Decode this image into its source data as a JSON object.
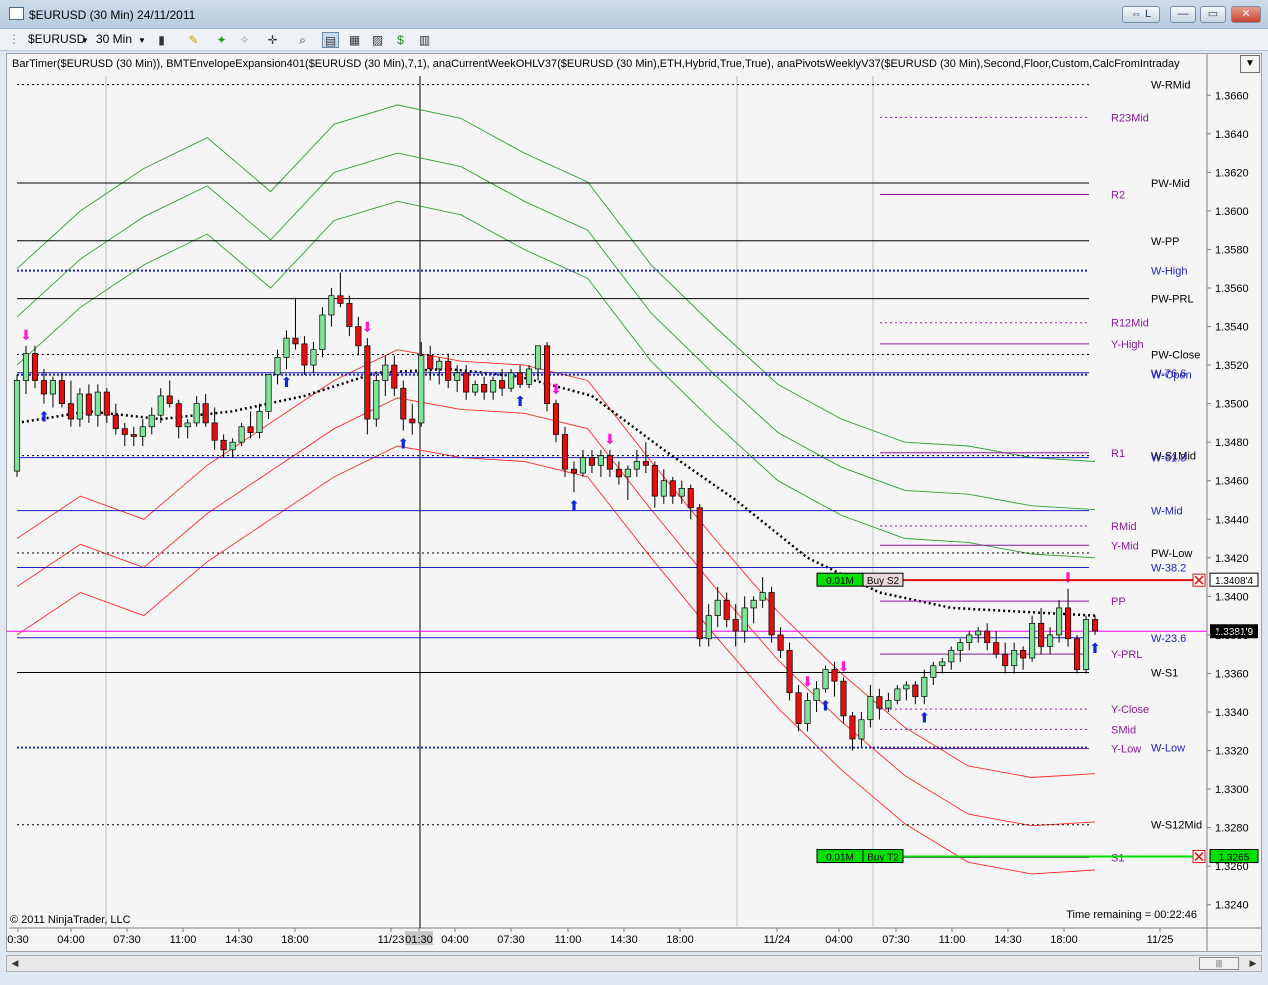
{
  "window": {
    "title": "$EURUSD (30 Min)  24/11/2011",
    "buttons": [
      "⇔ L",
      "—",
      "▭",
      "✕"
    ]
  },
  "toolbar": {
    "instrument": "$EURUSD",
    "interval": "30 Min"
  },
  "indicator_label": "BarTimer($EURUSD (30 Min)), BMTEnvelopeExpansion401($EURUSD (30 Min),7,1), anaCurrentWeekOHLV37($EURUSD (30 Min),ETH,Hybrid,True,True), anaPivotsWeeklyV37($EURUSD (30 Min),Second,Floor,Custom,CalcFromIntraday",
  "copyright": "© 2011 NinjaTrader, LLC",
  "time_remaining": "Time remaining = 00:22:46",
  "colors": {
    "up": "#7fe39a",
    "down": "#e01010",
    "green_env": "#2ea02e",
    "red_env": "#ff2a2a",
    "pivot": "#8b1a9e",
    "weekly_blue": "#1f1fbf",
    "dotted_black": "#000000",
    "crosshair": "#ff00ff"
  },
  "chart_data": {
    "type": "candlestick",
    "instrument": "$EURUSD",
    "timeframe": "30 Min",
    "y_range": [
      1.323,
      1.367
    ],
    "y_ticks": [
      "1.3660",
      "1.3640",
      "1.3620",
      "1.3600",
      "1.3580",
      "1.3560",
      "1.3540",
      "1.3520",
      "1.3500",
      "1.3480",
      "1.3460",
      "1.3440",
      "1.3420",
      "1.3400",
      "1.3380",
      "1.3360",
      "1.3340",
      "1.3320",
      "1.3300",
      "1.3280",
      "1.3260",
      "1.3240"
    ],
    "x_ticks": [
      "0:30",
      "04:00",
      "07:30",
      "11:00",
      "14:30",
      "18:00",
      "11/23",
      "01:30",
      "04:00",
      "07:30",
      "11:00",
      "14:30",
      "18:00",
      "11/24",
      "04:00",
      "07:30",
      "11:00",
      "14:30",
      "18:00",
      "11/25"
    ],
    "candles": [
      [
        1.3465,
        1.3515,
        1.3462,
        1.3512
      ],
      [
        1.3512,
        1.353,
        1.3505,
        1.3526
      ],
      [
        1.3526,
        1.353,
        1.3508,
        1.3512
      ],
      [
        1.3512,
        1.3518,
        1.35,
        1.3505
      ],
      [
        1.3505,
        1.3514,
        1.3498,
        1.3512
      ],
      [
        1.3512,
        1.3516,
        1.3498,
        1.35
      ],
      [
        1.35,
        1.3512,
        1.3488,
        1.3492
      ],
      [
        1.3492,
        1.3508,
        1.3488,
        1.3505
      ],
      [
        1.3505,
        1.351,
        1.349,
        1.3494
      ],
      [
        1.3494,
        1.351,
        1.3488,
        1.3506
      ],
      [
        1.3506,
        1.3508,
        1.349,
        1.3494
      ],
      [
        1.3494,
        1.35,
        1.3484,
        1.3487
      ],
      [
        1.3487,
        1.349,
        1.3478,
        1.3484
      ],
      [
        1.3484,
        1.3488,
        1.3478,
        1.3483
      ],
      [
        1.3483,
        1.3492,
        1.3478,
        1.3488
      ],
      [
        1.3488,
        1.3498,
        1.3484,
        1.3494
      ],
      [
        1.3494,
        1.3508,
        1.349,
        1.3504
      ],
      [
        1.3504,
        1.3512,
        1.3498,
        1.35
      ],
      [
        1.35,
        1.3502,
        1.3482,
        1.3488
      ],
      [
        1.3488,
        1.3492,
        1.3482,
        1.349
      ],
      [
        1.349,
        1.3504,
        1.3488,
        1.35
      ],
      [
        1.35,
        1.3505,
        1.3488,
        1.349
      ],
      [
        1.349,
        1.3498,
        1.3476,
        1.3481
      ],
      [
        1.3481,
        1.3484,
        1.3472,
        1.3476
      ],
      [
        1.3476,
        1.3482,
        1.3472,
        1.348
      ],
      [
        1.348,
        1.349,
        1.3478,
        1.3488
      ],
      [
        1.3488,
        1.3496,
        1.3482,
        1.3485
      ],
      [
        1.3485,
        1.35,
        1.3482,
        1.3496
      ],
      [
        1.3496,
        1.3515,
        1.3492,
        1.3515
      ],
      [
        1.3515,
        1.3528,
        1.351,
        1.3524
      ],
      [
        1.3524,
        1.3538,
        1.3518,
        1.3534
      ],
      [
        1.3534,
        1.3555,
        1.3528,
        1.3531
      ],
      [
        1.3531,
        1.3535,
        1.3515,
        1.352
      ],
      [
        1.352,
        1.3532,
        1.3516,
        1.3528
      ],
      [
        1.3528,
        1.355,
        1.3524,
        1.3546
      ],
      [
        1.3546,
        1.356,
        1.354,
        1.3556
      ],
      [
        1.3556,
        1.3568,
        1.355,
        1.3552
      ],
      [
        1.3552,
        1.3556,
        1.3535,
        1.354
      ],
      [
        1.354,
        1.3545,
        1.3525,
        1.353
      ],
      [
        1.353,
        1.3534,
        1.3484,
        1.3492
      ],
      [
        1.3492,
        1.3515,
        1.3488,
        1.3512
      ],
      [
        1.3512,
        1.3525,
        1.3504,
        1.352
      ],
      [
        1.352,
        1.3525,
        1.3504,
        1.3508
      ],
      [
        1.3508,
        1.3512,
        1.3486,
        1.3492
      ],
      [
        1.3492,
        1.35,
        1.3484,
        1.349
      ],
      [
        1.349,
        1.3532,
        1.3488,
        1.3525
      ],
      [
        1.3525,
        1.353,
        1.3512,
        1.3518
      ],
      [
        1.3518,
        1.3524,
        1.351,
        1.3522
      ],
      [
        1.3522,
        1.3526,
        1.3508,
        1.3512
      ],
      [
        1.3512,
        1.352,
        1.3506,
        1.3516
      ],
      [
        1.3516,
        1.352,
        1.3502,
        1.3506
      ],
      [
        1.3506,
        1.3512,
        1.3504,
        1.351
      ],
      [
        1.351,
        1.3514,
        1.3502,
        1.3506
      ],
      [
        1.3506,
        1.3514,
        1.3502,
        1.3512
      ],
      [
        1.3512,
        1.3518,
        1.3504,
        1.3508
      ],
      [
        1.3508,
        1.3518,
        1.3506,
        1.3516
      ],
      [
        1.3516,
        1.352,
        1.3508,
        1.351
      ],
      [
        1.351,
        1.352,
        1.3508,
        1.3518
      ],
      [
        1.3518,
        1.353,
        1.3512,
        1.353
      ],
      [
        1.353,
        1.3532,
        1.3496,
        1.35
      ],
      [
        1.35,
        1.3502,
        1.348,
        1.3484
      ],
      [
        1.3484,
        1.3488,
        1.3462,
        1.3466
      ],
      [
        1.3466,
        1.347,
        1.3454,
        1.3464
      ],
      [
        1.3464,
        1.3476,
        1.3462,
        1.3472
      ],
      [
        1.3472,
        1.3476,
        1.3464,
        1.3468
      ],
      [
        1.3468,
        1.3476,
        1.3462,
        1.3473
      ],
      [
        1.3473,
        1.3476,
        1.3462,
        1.3466
      ],
      [
        1.3466,
        1.347,
        1.3458,
        1.3462
      ],
      [
        1.3462,
        1.3468,
        1.345,
        1.3466
      ],
      [
        1.3466,
        1.3476,
        1.3462,
        1.347
      ],
      [
        1.347,
        1.348,
        1.3464,
        1.3468
      ],
      [
        1.3468,
        1.347,
        1.3446,
        1.3452
      ],
      [
        1.3452,
        1.3466,
        1.3448,
        1.346
      ],
      [
        1.346,
        1.3462,
        1.3448,
        1.3452
      ],
      [
        1.3452,
        1.346,
        1.3448,
        1.3456
      ],
      [
        1.3456,
        1.3458,
        1.344,
        1.3446
      ],
      [
        1.3446,
        1.3448,
        1.3374,
        1.3378
      ],
      [
        1.3378,
        1.3396,
        1.3374,
        1.339
      ],
      [
        1.339,
        1.3405,
        1.3384,
        1.3398
      ],
      [
        1.3398,
        1.3402,
        1.3384,
        1.3388
      ],
      [
        1.3388,
        1.3396,
        1.3374,
        1.3382
      ],
      [
        1.3382,
        1.34,
        1.3376,
        1.3394
      ],
      [
        1.3394,
        1.34,
        1.3386,
        1.3398
      ],
      [
        1.3398,
        1.341,
        1.3394,
        1.3402
      ],
      [
        1.3402,
        1.3405,
        1.3376,
        1.338
      ],
      [
        1.338,
        1.3384,
        1.3368,
        1.3372
      ],
      [
        1.3372,
        1.3376,
        1.3346,
        1.335
      ],
      [
        1.335,
        1.3354,
        1.333,
        1.3334
      ],
      [
        1.3334,
        1.335,
        1.333,
        1.3346
      ],
      [
        1.3346,
        1.3356,
        1.334,
        1.3352
      ],
      [
        1.3352,
        1.3364,
        1.335,
        1.3362
      ],
      [
        1.3362,
        1.3366,
        1.3348,
        1.3356
      ],
      [
        1.3356,
        1.3358,
        1.3334,
        1.3338
      ],
      [
        1.3338,
        1.334,
        1.332,
        1.3326
      ],
      [
        1.3326,
        1.334,
        1.3322,
        1.3336
      ],
      [
        1.3336,
        1.3354,
        1.3332,
        1.3348
      ],
      [
        1.3348,
        1.3352,
        1.3336,
        1.3342
      ],
      [
        1.3342,
        1.335,
        1.334,
        1.3346
      ],
      [
        1.3346,
        1.3354,
        1.3344,
        1.3352
      ],
      [
        1.3352,
        1.3356,
        1.3346,
        1.3354
      ],
      [
        1.3354,
        1.3356,
        1.3344,
        1.3348
      ],
      [
        1.3348,
        1.3362,
        1.3344,
        1.3358
      ],
      [
        1.3358,
        1.3366,
        1.3354,
        1.3364
      ],
      [
        1.3364,
        1.3368,
        1.336,
        1.3366
      ],
      [
        1.3366,
        1.3374,
        1.3362,
        1.3372
      ],
      [
        1.3372,
        1.3378,
        1.3366,
        1.3376
      ],
      [
        1.3376,
        1.3382,
        1.3372,
        1.338
      ],
      [
        1.338,
        1.3384,
        1.3376,
        1.3382
      ],
      [
        1.3382,
        1.3386,
        1.3372,
        1.3376
      ],
      [
        1.3376,
        1.3382,
        1.3368,
        1.337
      ],
      [
        1.337,
        1.3376,
        1.336,
        1.3364
      ],
      [
        1.3364,
        1.3376,
        1.336,
        1.3372
      ],
      [
        1.3372,
        1.3374,
        1.3362,
        1.3368
      ],
      [
        1.3368,
        1.339,
        1.3366,
        1.3386
      ],
      [
        1.3386,
        1.3394,
        1.337,
        1.3374
      ],
      [
        1.3374,
        1.3384,
        1.337,
        1.338
      ],
      [
        1.338,
        1.3398,
        1.3376,
        1.3394
      ],
      [
        1.3394,
        1.3404,
        1.3374,
        1.3378
      ],
      [
        1.3378,
        1.338,
        1.336,
        1.3362
      ],
      [
        1.3362,
        1.339,
        1.336,
        1.3388
      ],
      [
        1.3388,
        1.339,
        1.338,
        1.3382
      ]
    ],
    "envelope_green": [
      1.357,
      1.36,
      1.3622,
      1.3638,
      1.361,
      1.3645,
      1.3655,
      1.3648,
      1.363,
      1.3615,
      1.3572,
      1.354,
      1.351,
      1.3492,
      1.348,
      1.3478,
      1.3472,
      1.347
    ],
    "envelope_red": [
      1.338,
      1.3402,
      1.339,
      1.3418,
      1.344,
      1.3462,
      1.3478,
      1.3472,
      1.347,
      1.3462,
      1.342,
      1.338,
      1.3342,
      1.331,
      1.3282,
      1.3262,
      1.3256,
      1.3258
    ],
    "dotted_ma": [
      1.349,
      1.3496,
      1.3492,
      1.3496,
      1.3504,
      1.3516,
      1.3518,
      1.3514,
      1.3504,
      1.3476,
      1.345,
      1.342,
      1.3402,
      1.3394,
      1.3392,
      1.339
    ],
    "levels": [
      {
        "price": 1.36655,
        "label": "W-RMid",
        "color": "#000000",
        "style": "dotted",
        "from": "left"
      },
      {
        "price": 1.36485,
        "label": "R23Mid",
        "color": "#8b1a9e",
        "style": "dotted",
        "from": "right"
      },
      {
        "price": 1.36145,
        "label": "PW-Mid",
        "color": "#000000",
        "style": "solid",
        "from": "left"
      },
      {
        "price": 1.36085,
        "label": "R2",
        "color": "#8b1a9e",
        "style": "solid",
        "from": "right"
      },
      {
        "price": 1.35845,
        "label": "W-PP",
        "color": "#000000",
        "style": "solid",
        "from": "left"
      },
      {
        "price": 1.3569,
        "label": "W-High",
        "color": "#1f1fbf",
        "style": "dotted",
        "from": "left"
      },
      {
        "price": 1.35545,
        "label": "PW-PRL",
        "color": "#000000",
        "style": "solid",
        "from": "left"
      },
      {
        "price": 1.3542,
        "label": "R12Mid",
        "color": "#8b1a9e",
        "style": "dotted",
        "from": "right"
      },
      {
        "price": 1.3531,
        "label": "Y-High",
        "color": "#8b1a9e",
        "style": "solid",
        "from": "right"
      },
      {
        "price": 1.35255,
        "label": "PW-Close",
        "color": "#000000",
        "style": "dotted",
        "from": "left"
      },
      {
        "price": 1.3515,
        "label": "W-Open",
        "color": "#1f1fbf",
        "style": "dotted",
        "from": "left"
      },
      {
        "price": 1.3516,
        "label": "W-76.6",
        "color": "#1f1fbf",
        "style": "solid",
        "from": "left"
      },
      {
        "price": 1.34745,
        "label": "R1",
        "color": "#8b1a9e",
        "style": "solid",
        "from": "right"
      },
      {
        "price": 1.3473,
        "label": "W-S1Mid",
        "color": "#000000",
        "style": "dotted",
        "from": "left"
      },
      {
        "price": 1.3472,
        "label": "W-61.8",
        "color": "#1f1fbf",
        "style": "solid",
        "from": "left"
      },
      {
        "price": 1.34445,
        "label": "W-Mid",
        "color": "#1f1fbf",
        "style": "solid",
        "from": "left"
      },
      {
        "price": 1.34365,
        "label": "RMid",
        "color": "#8b1a9e",
        "style": "dotted",
        "from": "right"
      },
      {
        "price": 1.34265,
        "label": "Y-Mid",
        "color": "#8b1a9e",
        "style": "solid",
        "from": "right"
      },
      {
        "price": 1.34225,
        "label": "PW-Low",
        "color": "#000000",
        "style": "dotted",
        "from": "left"
      },
      {
        "price": 1.3415,
        "label": "W-38.2",
        "color": "#1f1fbf",
        "style": "solid",
        "from": "left"
      },
      {
        "price": 1.33975,
        "label": "PP",
        "color": "#8b1a9e",
        "style": "solid",
        "from": "right"
      },
      {
        "price": 1.33785,
        "label": "W-23.6",
        "color": "#1f1fbf",
        "style": "solid",
        "from": "left"
      },
      {
        "price": 1.337,
        "label": "Y-PRL",
        "color": "#8b1a9e",
        "style": "solid",
        "from": "right"
      },
      {
        "price": 1.33605,
        "label": "W-S1",
        "color": "#000000",
        "style": "solid",
        "from": "left"
      },
      {
        "price": 1.33415,
        "label": "Y-Close",
        "color": "#8b1a9e",
        "style": "dotted",
        "from": "right"
      },
      {
        "price": 1.3331,
        "label": "SMid",
        "color": "#8b1a9e",
        "style": "dotted",
        "from": "right"
      },
      {
        "price": 1.3321,
        "label": "Y-Low",
        "color": "#8b1a9e",
        "style": "solid",
        "from": "right"
      },
      {
        "price": 1.33215,
        "label": "W-Low",
        "color": "#1f1fbf",
        "style": "dotted",
        "from": "left"
      },
      {
        "price": 1.32815,
        "label": "W-S12Mid",
        "color": "#000000",
        "style": "dotted",
        "from": "left"
      },
      {
        "price": 1.32645,
        "label": "S1",
        "color": "#8b1a9e",
        "style": "solid",
        "from": "right"
      }
    ],
    "orders": [
      {
        "price": 1.34084,
        "qty": "0.01M",
        "label": "Buy S2",
        "tag": "1.3408'4",
        "color": "#e8d8d8"
      },
      {
        "price": 1.3265,
        "qty": "0.01M",
        "label": "Buy T2",
        "tag": "1.3265",
        "color": "#00e000"
      }
    ],
    "last_price_tag": "1.3381'9",
    "crosshair_price": 1.33819,
    "session_breaks": [
      "11/23",
      "11/24",
      "11/25"
    ]
  }
}
